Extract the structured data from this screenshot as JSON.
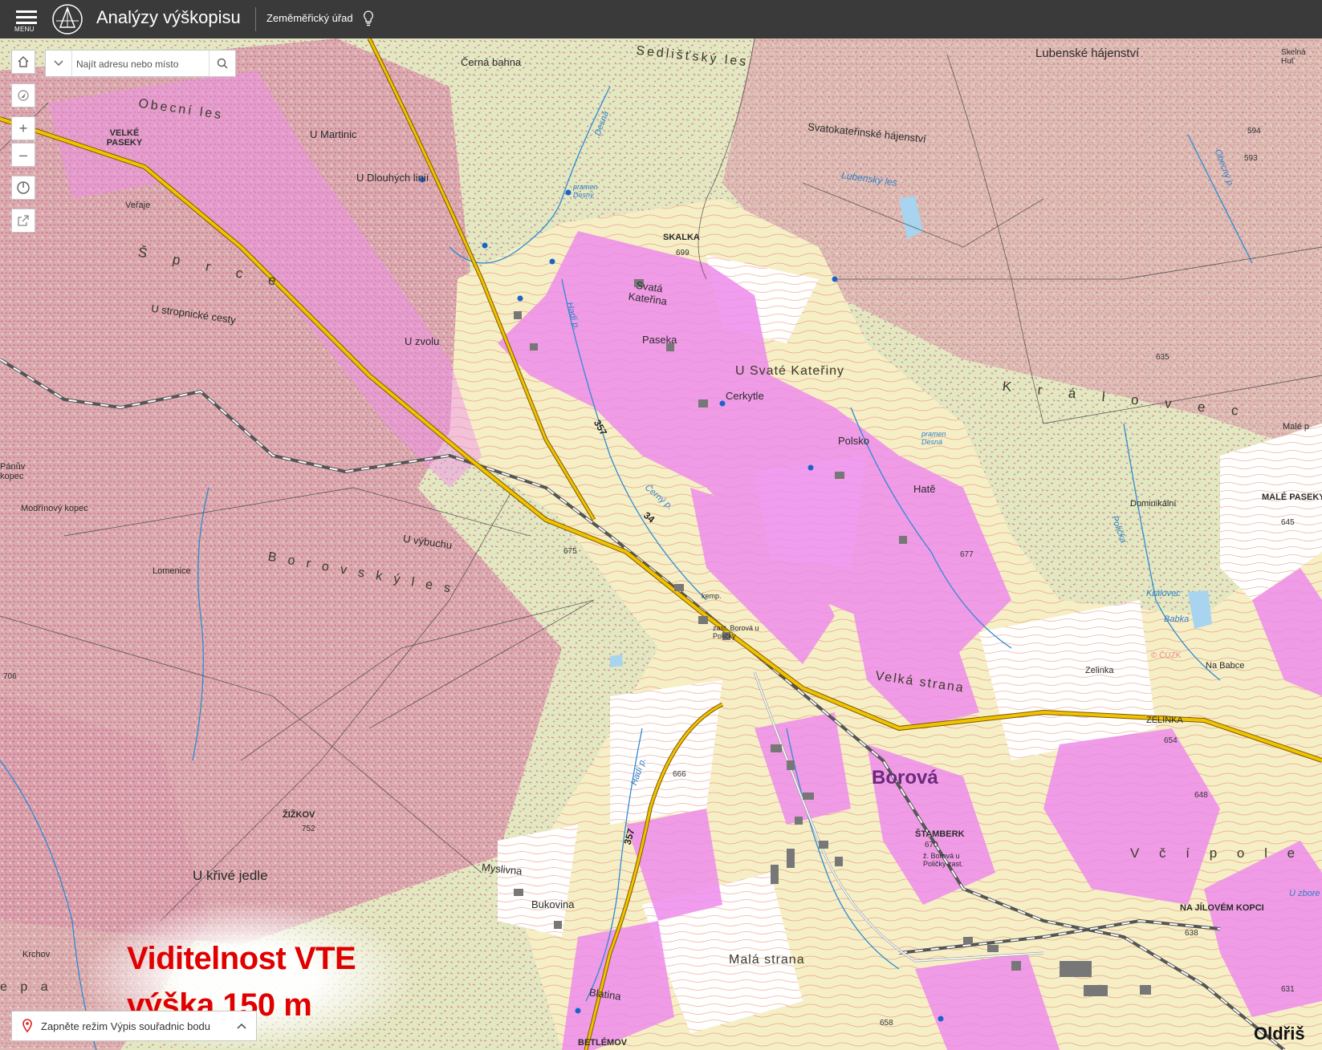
{
  "header": {
    "menu_label": "MENU",
    "title": "Analýzy výškopisu",
    "organization": "Zeměměřický úřad"
  },
  "search": {
    "placeholder": "Najít adresu nebo místo"
  },
  "coordinate_bar": {
    "label": "Zapněte režim Výpis souřadnic bodu"
  },
  "overlay": {
    "title": "Viditelnost VTE",
    "subtitle": "výška 150 m"
  },
  "colors": {
    "forest": "#e6ecc8",
    "meadow": "#f4f0c8",
    "visibility": "#ee8cec",
    "road_major": "#f2c200",
    "highlight_text": "#e00000"
  },
  "map_labels": {
    "obecni_les": "Obecní les",
    "velke_paseky": "VELKÉ PASEKY",
    "cerna_bahna": "Černá bahna",
    "sedlistsky_les": "Sedlišťský les",
    "lubenske_hajenstvi": "Lubenské hájenství",
    "svatokaterinske_hajenstvi": "Svatokateřinské hájenství",
    "lubensky_les": "Lubenský les",
    "skalka": "SKALKA",
    "u_martinic": "U Martinic",
    "u_dlouhych_linii": "U Dlouhých linií",
    "veraje": "Veřaje",
    "sprce": "Š p r c e",
    "u_stropnicke_cesty": "U stropnické cesty",
    "u_zvolu": "U zvolu",
    "svata_katerina": "Svatá Kateřina",
    "paseka": "Paseka",
    "u_svate_kateriny": "U Svaté Kateřiny",
    "cerkytle": "Cerkytle",
    "kralovec": "K r á l o v e c",
    "polsko": "Polsko",
    "hate": "Hatě",
    "panuv_kopec": "Pánův kopec",
    "modrinovy_kopec": "Modřínový kopec",
    "u_vybuchu": "U výbuchu",
    "lomenice": "Lomenice",
    "borovsky_les": "B o r o v s k ý  l e s",
    "dominikalni": "Dominikální",
    "male_paseky": "MALÉ PASEKY",
    "male_p": "Malé p",
    "kralovec_water": "Královec",
    "babka": "Babka",
    "zelinka": "Zelinka",
    "zelinka_caps": "ZELINKA",
    "na_babce": "Na Babce",
    "velka_strana": "Velká strana",
    "borova": "Borová",
    "stamberk": "ŠTAMBERK",
    "zizkov": "ŽIŽKOV",
    "u_krive_jedle": "U křivé jedle",
    "myslivna": "Myslivna",
    "bukovina": "Bukovina",
    "mala_strana": "Malá strana",
    "blatina": "Blatina",
    "betlemov": "BETLÉMOV",
    "vcli_pole": "V č í  p o l e",
    "na_jilovem_kopci": "NA JÍLOVÉM KOPCI",
    "u_zbore": "U zbore",
    "oldris": "Oldřiš",
    "krchov": "Krchov",
    "e_pa": "e p a",
    "komp": "kemp.",
    "zast_borova": "zast. Borová u Poličky",
    "z_borova": "ž. Borová u Poličky zast.",
    "cerny_p": "Černý p.",
    "hadi_p": "Hadí p.",
    "obecny_p": "Obecný p.",
    "politek": "Polička",
    "desna": "Desná",
    "pramen_desny": "pramen Desný",
    "pramen_desna": "pramen Desná",
    "haduvk": "Hadí p.",
    "skelna_hut": "Skelná Huť",
    "cuzk": "© ČÚZK"
  },
  "heights": {
    "h699": "699",
    "h594": "594",
    "h593": "593",
    "h635": "635",
    "h675": "675",
    "h677": "677",
    "h645": "645",
    "h706": "706",
    "h752": "752",
    "h666": "666",
    "h670": "670",
    "h654": "654",
    "h648": "648",
    "h638": "638",
    "h658": "658",
    "h631": "631"
  },
  "road_numbers": {
    "r357a": "357",
    "r34": "34",
    "r357b": "357"
  }
}
